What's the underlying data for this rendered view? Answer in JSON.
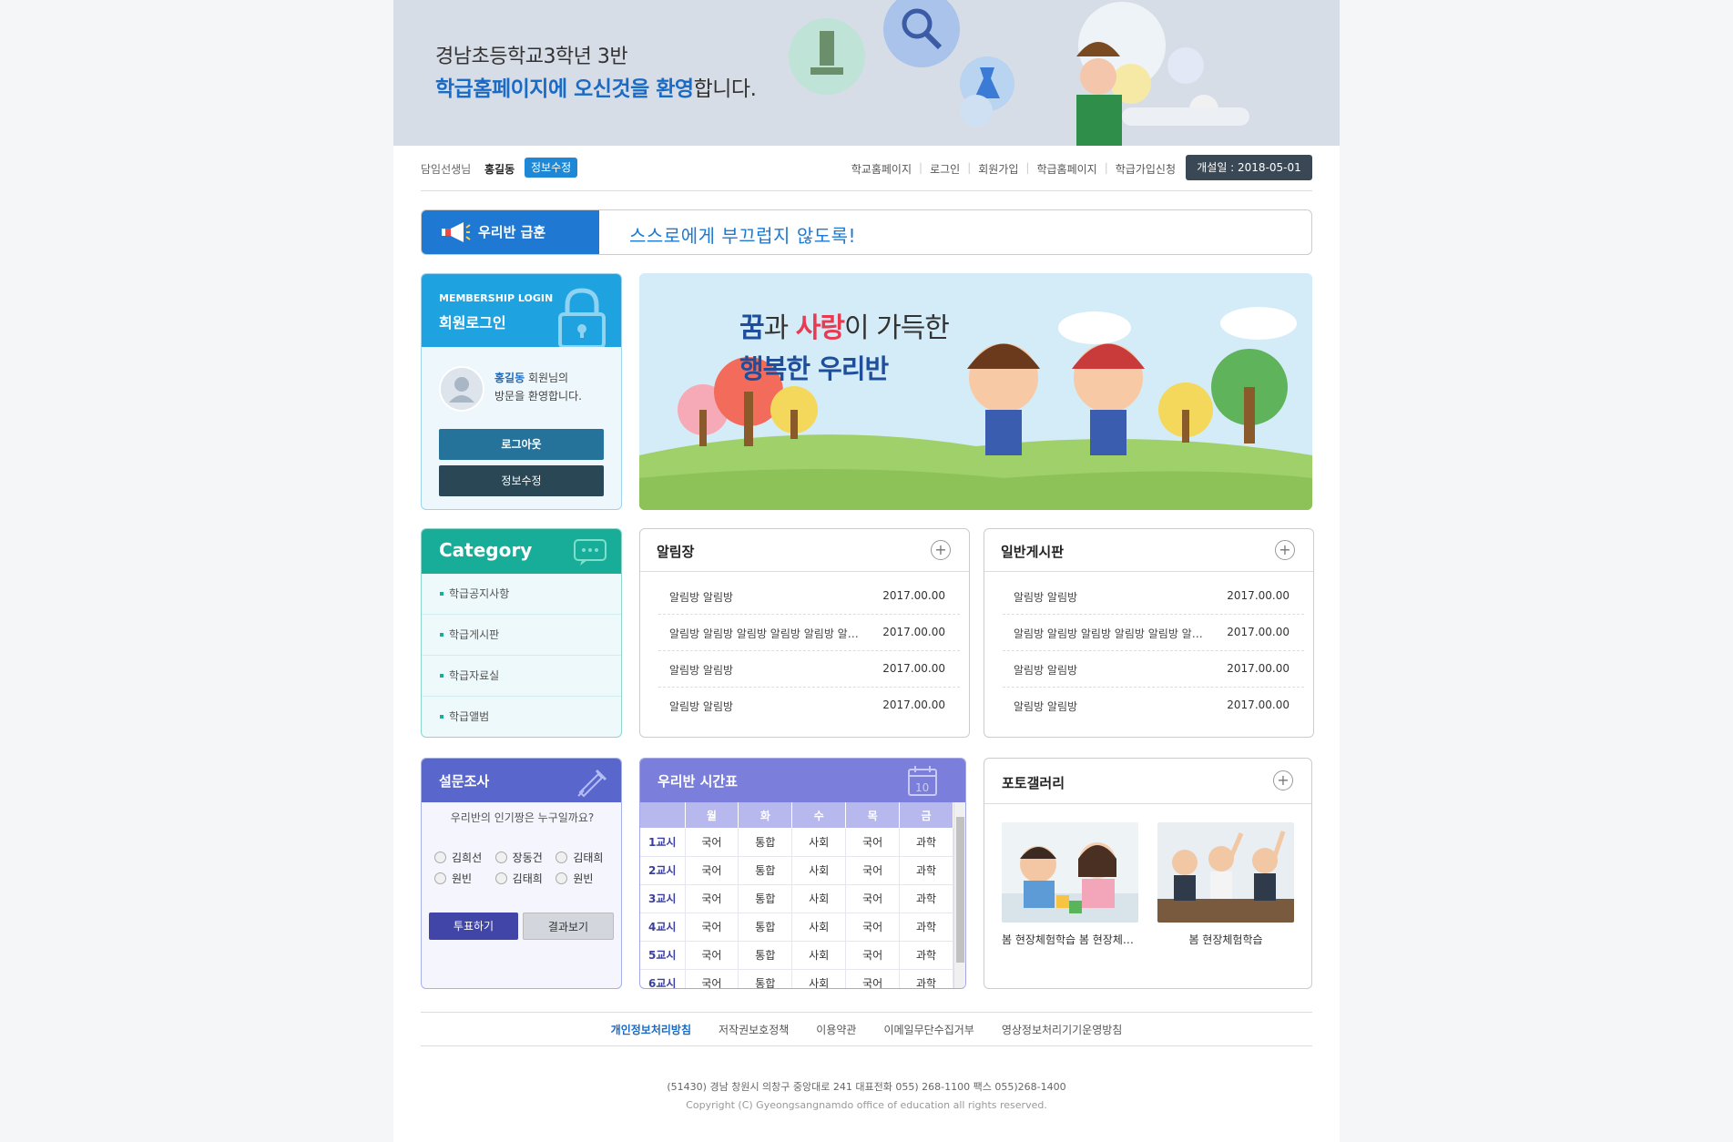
{
  "banner": {
    "line1": "경남초등학교3학년 3반",
    "line2_highlight": "학급홈페이지에 오신것을 환영",
    "line2_rest": "합니다."
  },
  "topbar": {
    "teacher_label": "담임선생님",
    "teacher_name": "홍길동",
    "edit_label": "정보수정",
    "links": [
      "학교홈페이지",
      "로그인",
      "회원가입",
      "학급홈페이지",
      "학급가입신청"
    ],
    "open_date": "개설일 : 2018-05-01"
  },
  "motto": {
    "label": "우리반 급훈",
    "text": "스스로에게 부끄럽지 않도록!"
  },
  "login": {
    "title_en": "MEMBERSHIP LOGIN",
    "title_ko": "회원로그인",
    "user_name": "홍길동",
    "welcome_suffix": " 회원님의",
    "welcome_line2": "방문을 환영합니다.",
    "logout_label": "로그아웃",
    "edit_label": "정보수정"
  },
  "hero": {
    "t1_a": "꿈",
    "t1_b": "과 ",
    "t1_c": "사랑",
    "t1_d": "이 가득한",
    "t2": "행복한 우리반"
  },
  "category": {
    "title": "Category",
    "items": [
      "학급공지사항",
      "학급게시판",
      "학급자료실",
      "학급앨범"
    ]
  },
  "notice": {
    "title": "알림장",
    "rows": [
      {
        "title": "알림방 알림방",
        "date": "2017.00.00"
      },
      {
        "title": "알림방 알림방 알림방 알림방 알림방 알림방",
        "date": "2017.00.00"
      },
      {
        "title": "알림방 알림방",
        "date": "2017.00.00"
      },
      {
        "title": "알림방 알림방",
        "date": "2017.00.00"
      }
    ]
  },
  "board": {
    "title": "일반게시판",
    "rows": [
      {
        "title": "알림방 알림방",
        "date": "2017.00.00"
      },
      {
        "title": "알림방 알림방 알림방 알림방 알림방 알림방",
        "date": "2017.00.00"
      },
      {
        "title": "알림방 알림방",
        "date": "2017.00.00"
      },
      {
        "title": "알림방 알림방",
        "date": "2017.00.00"
      }
    ]
  },
  "survey": {
    "title": "설문조사",
    "question": "우리반의 인기짱은 누구일까요?",
    "options": [
      "김희선",
      "장동건",
      "김태희",
      "원빈",
      "김태희",
      "원빈"
    ],
    "vote_label": "투표하기",
    "result_label": "결과보기"
  },
  "timetable": {
    "title": "우리반 시간표",
    "days": [
      "월",
      "화",
      "수",
      "목",
      "금"
    ],
    "rows": [
      {
        "period": "1교시",
        "subjects": [
          "국어",
          "통합",
          "사회",
          "국어",
          "과학"
        ]
      },
      {
        "period": "2교시",
        "subjects": [
          "국어",
          "통합",
          "사회",
          "국어",
          "과학"
        ]
      },
      {
        "period": "3교시",
        "subjects": [
          "국어",
          "통합",
          "사회",
          "국어",
          "과학"
        ]
      },
      {
        "period": "4교시",
        "subjects": [
          "국어",
          "통합",
          "사회",
          "국어",
          "과학"
        ]
      },
      {
        "period": "5교시",
        "subjects": [
          "국어",
          "통합",
          "사회",
          "국어",
          "과학"
        ]
      },
      {
        "period": "6교시",
        "subjects": [
          "국어",
          "통합",
          "사회",
          "국어",
          "과학"
        ]
      }
    ]
  },
  "gallery": {
    "title": "포토갤러리",
    "items": [
      {
        "caption": "봄 현장체험학습 봄 현장체험학습"
      },
      {
        "caption": "봄 현장체험학습"
      }
    ]
  },
  "footer": {
    "links": [
      "개인정보처리방침",
      "저작권보호정책",
      "이용약관",
      "이메일무단수집거부",
      "영상정보처리기기운영방침"
    ],
    "address": "(51430) 경남 창원시 의창구 중앙대로 241 대표전화 055) 268-1100 팩스 055)268-1400",
    "copyright": "Copyright (C) Gyeongsangnamdo office of education all rights reserved."
  },
  "colors": {
    "brand_blue": "#1f78d1",
    "login_blue": "#1fa2e0",
    "category_teal": "#18ad98",
    "survey_indigo": "#5967cc",
    "timetable_violet": "#7b7fdb"
  }
}
